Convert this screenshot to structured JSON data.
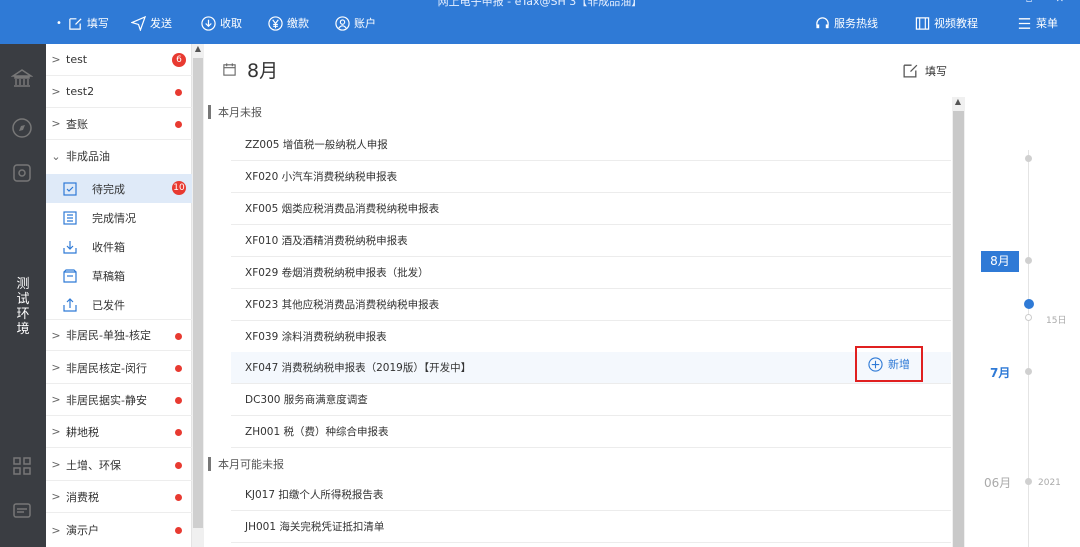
{
  "window": {
    "title": "网上电子申报 - eTax@SH 3【非成品油】",
    "controls": "— ▫ ✕"
  },
  "toolbar": {
    "items": [
      {
        "label": "填写",
        "icon": "edit-icon"
      },
      {
        "label": "发送",
        "icon": "send-icon"
      },
      {
        "label": "收取",
        "icon": "download-icon"
      },
      {
        "label": "缴款",
        "icon": "yen-icon"
      },
      {
        "label": "账户",
        "icon": "user-icon"
      }
    ],
    "right": [
      {
        "label": "服务热线",
        "icon": "headset-icon"
      },
      {
        "label": "视频教程",
        "icon": "video-icon"
      },
      {
        "label": "菜单",
        "icon": "menu-icon"
      }
    ]
  },
  "rail": {
    "env_label": [
      "测",
      "试",
      "环",
      "境"
    ],
    "icons": [
      "bank-icon",
      "compass-icon",
      "mail-icon",
      "grid-icon",
      "message-icon"
    ]
  },
  "sidebar": {
    "groups": [
      {
        "label": "test",
        "badge": "6"
      },
      {
        "label": "test2",
        "dot": true
      },
      {
        "label": "查账",
        "dot": true
      },
      {
        "label": "非成品油",
        "expanded": true
      }
    ],
    "sub_items": [
      {
        "label": "待完成",
        "badge": "10",
        "active": true,
        "icon": "check-clipboard-icon"
      },
      {
        "label": "完成情况",
        "icon": "list-icon"
      },
      {
        "label": "收件箱",
        "icon": "inbox-icon"
      },
      {
        "label": "草稿箱",
        "icon": "draft-icon"
      },
      {
        "label": "已发件",
        "icon": "outbox-icon"
      }
    ],
    "more_groups": [
      {
        "label": "非居民-单独-核定",
        "dot": true
      },
      {
        "label": "非居民核定-闵行",
        "dot": true
      },
      {
        "label": "非居民据实-静安",
        "dot": true
      },
      {
        "label": "耕地税",
        "dot": true
      },
      {
        "label": "土增、环保",
        "dot": true
      },
      {
        "label": "消费税",
        "dot": true
      },
      {
        "label": "演示户",
        "dot": true
      }
    ]
  },
  "main": {
    "month_title": "8月",
    "fill_label": "填写",
    "section1_title": "本月未报",
    "section1_items": [
      "ZZ005 增值税一般纳税人申报",
      "XF020 小汽车消费税纳税申报表",
      "XF005 烟类应税消费品消费税纳税申报表",
      "XF010 酒及酒精消费税纳税申报表",
      "XF029 卷烟消费税纳税申报表（批发）",
      "XF023 其他应税消费品消费税纳税申报表",
      "XF039 涂料消费税纳税申报表",
      "XF047 消费税纳税申报表（2019版）【开发中】",
      "DC300 服务商满意度调查",
      "ZH001 税（费）种综合申报表"
    ],
    "new_button_label": "新增",
    "section2_title": "本月可能未报",
    "section2_items": [
      "KJ017 扣缴个人所得税报告表",
      "JH001 海关完税凭证抵扣清单"
    ]
  },
  "timeline": {
    "current": "8月",
    "prev": "7月",
    "older": "06月",
    "day_marker": "15日",
    "year": "2021"
  },
  "colors": {
    "brand_blue": "#2f7ad6",
    "alert_red": "#e83a31",
    "rail_dark": "#3a3d42"
  }
}
